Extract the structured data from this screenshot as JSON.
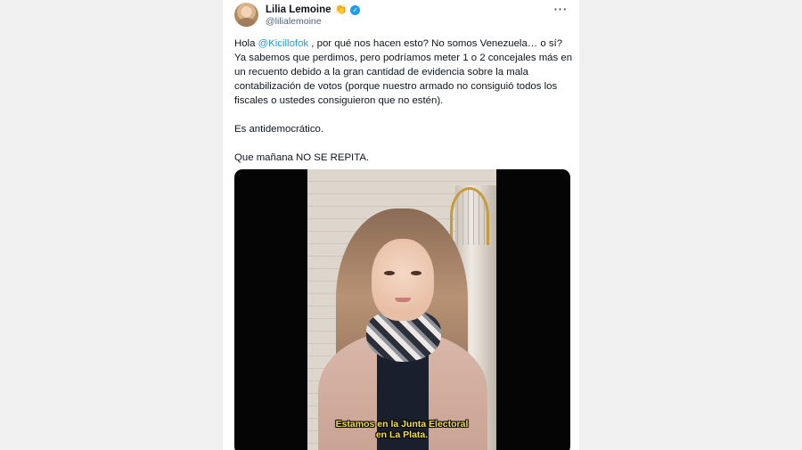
{
  "tweet": {
    "author_name": "Lilia Lemoine",
    "author_emoji": "👏",
    "verified_mark": "✓",
    "handle": "@lilialemoine",
    "more_menu": "···",
    "text": {
      "line1_prefix": "Hola ",
      "mention": "@Kicillofok",
      "line1_rest": " , por qué nos hacen esto? No somos Venezuela… o sí? Ya sabemos que perdimos, pero podríamos meter 1 o 2 concejales más en un recuento debido a la gran cantidad de evidencia sobre la mala contabilización de votos (porque nuestro armado no consiguió todos los fiscales o ustedes consiguieron que no estén).",
      "paragraph2": "Es antidemocrático.",
      "paragraph3": "Que mañana NO SE REPITA."
    },
    "video": {
      "subtitle_line1": "Estamos en la Junta Electoral",
      "subtitle_line2": "en La Plata."
    }
  },
  "colors": {
    "background": "#f0f0f0",
    "card": "#ffffff",
    "text": "#0f1419",
    "secondary": "#536471",
    "accent": "#1d9bf0",
    "subtitle": "#f7e33a"
  }
}
